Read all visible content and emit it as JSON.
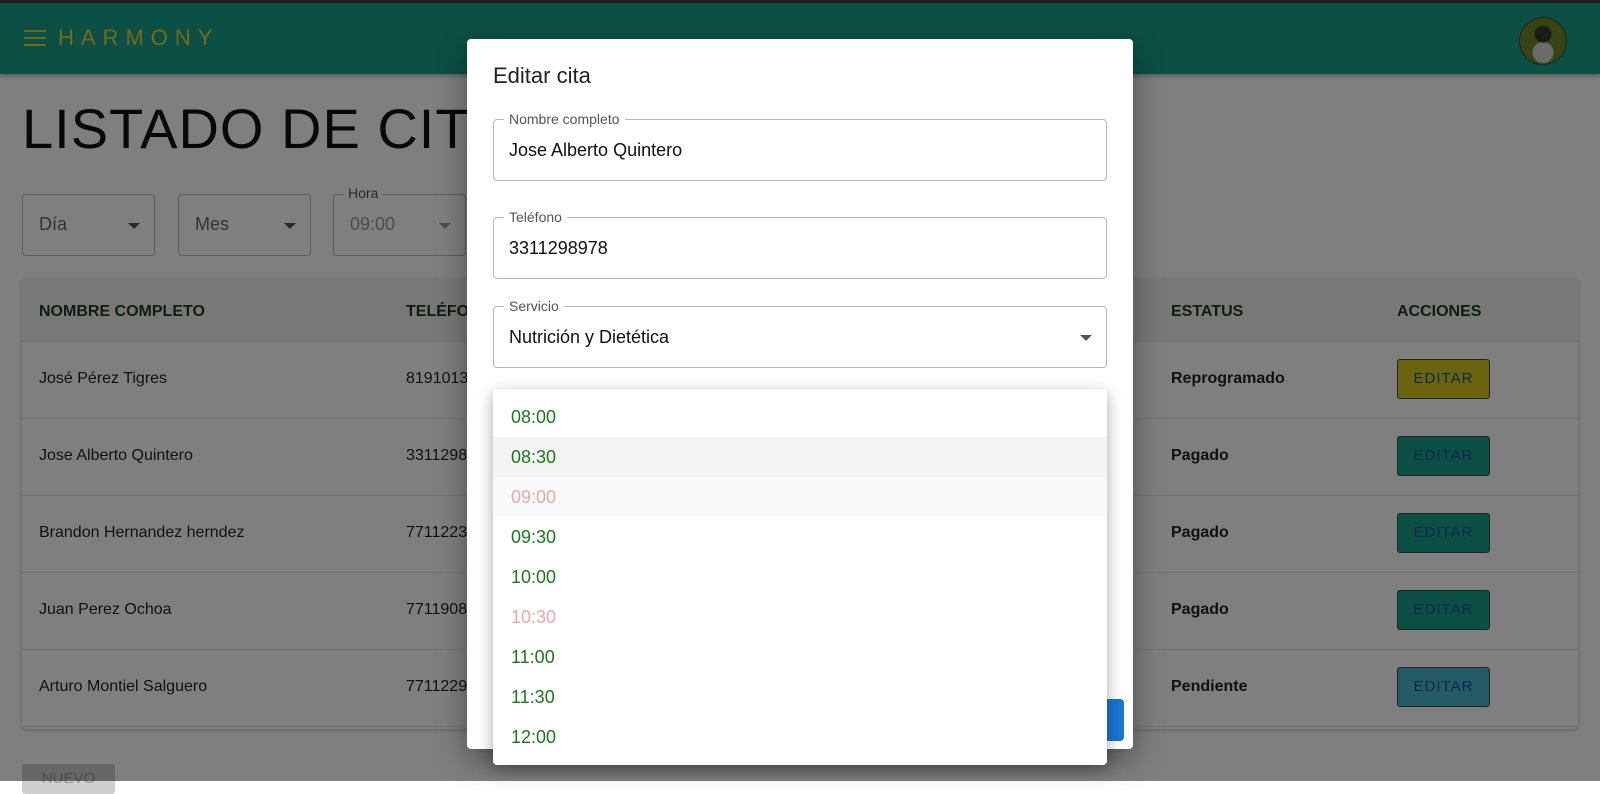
{
  "header": {
    "brand": "HARMONY",
    "menu_icon": "hamburger-icon",
    "avatar_icon": "user-avatar"
  },
  "page": {
    "title": "LISTADO DE CITAS",
    "filters": {
      "day": {
        "value": "Día"
      },
      "month": {
        "value": "Mes"
      },
      "hour": {
        "label": "Hora",
        "value": "09:00"
      }
    },
    "table": {
      "headers": {
        "name": "NOMBRE COMPLETO",
        "phone": "TELÉFONO",
        "status": "ESTATUS",
        "actions": "ACCIONES"
      },
      "rows": [
        {
          "name": "José Pérez Tigres",
          "phone": "8191013",
          "status": "Reprogramado",
          "action": "EDITAR",
          "color": "#d4c81c"
        },
        {
          "name": "Jose Alberto Quintero",
          "phone": "3311298",
          "status": "Pagado",
          "action": "EDITAR",
          "color": "#18a08a"
        },
        {
          "name": "Brandon Hernandez herndez",
          "phone": "7711223",
          "status": "Pagado",
          "action": "EDITAR",
          "color": "#18a08a"
        },
        {
          "name": "Juan Perez Ochoa",
          "phone": "7711908",
          "status": "Pagado",
          "action": "EDITAR",
          "color": "#18a08a"
        },
        {
          "name": "Arturo Montiel Salguero",
          "phone": "7711229",
          "status": "Pendiente",
          "action": "EDITAR",
          "color": "#4ab6cf"
        }
      ]
    },
    "new_button": "NUEVO"
  },
  "dialog": {
    "title": "Editar cita",
    "fields": {
      "name": {
        "label": "Nombre completo",
        "value": "Jose Alberto Quintero"
      },
      "phone": {
        "label": "Teléfono",
        "value": "3311298978"
      },
      "service": {
        "label": "Servicio",
        "value": "Nutrición y Dietética"
      }
    }
  },
  "time_menu": {
    "options": [
      {
        "label": "08:00",
        "available": true
      },
      {
        "label": "08:30",
        "available": true,
        "hovered": true
      },
      {
        "label": "09:00",
        "available": false,
        "selected": true
      },
      {
        "label": "09:30",
        "available": true
      },
      {
        "label": "10:00",
        "available": true
      },
      {
        "label": "10:30",
        "available": false
      },
      {
        "label": "11:00",
        "available": true
      },
      {
        "label": "11:30",
        "available": true
      },
      {
        "label": "12:00",
        "available": true
      }
    ],
    "colors": {
      "available": "#1a7a1a",
      "unavailable": "#f0a6a6"
    }
  }
}
